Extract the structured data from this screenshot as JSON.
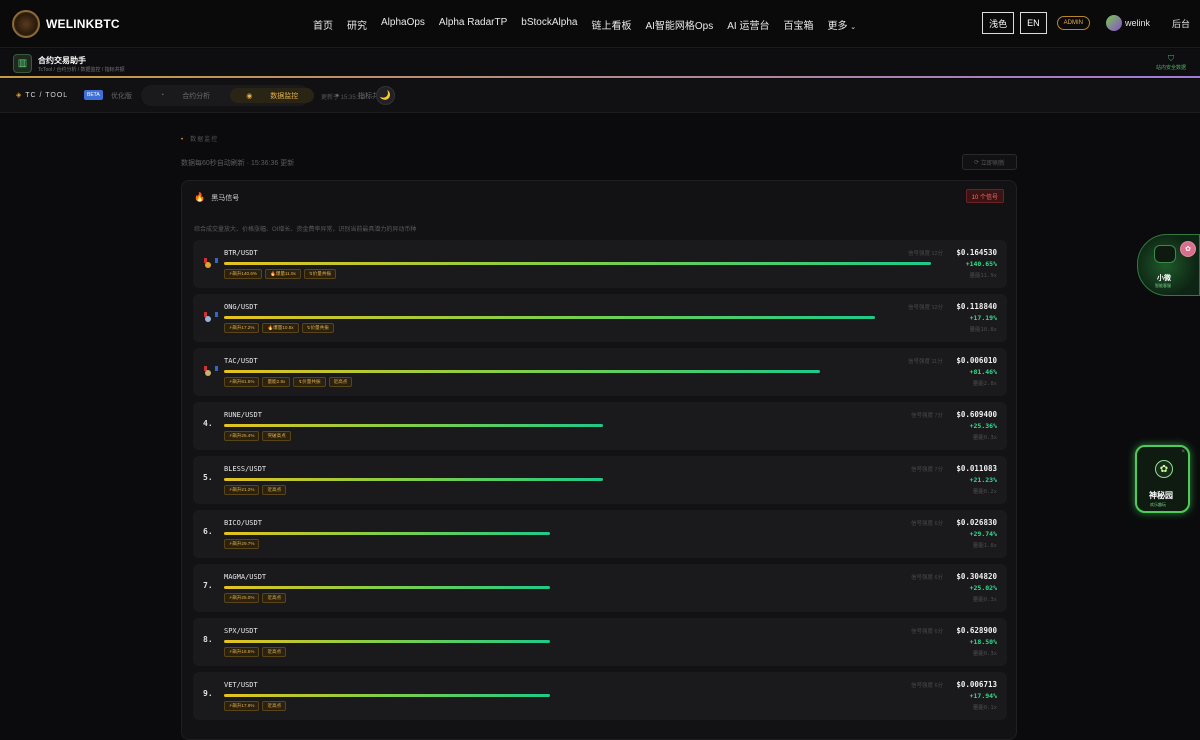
{
  "nav": {
    "brand": "WELINKBTC",
    "items": [
      "首页",
      "研究",
      "AlphaOps",
      "Alpha RadarTP",
      "bStockAlpha",
      "链上看板",
      "AI智能网格Ops",
      "AI 运营台",
      "百宝箱",
      "更多"
    ],
    "theme_btn": "浅色",
    "lang_btn": "EN",
    "admin_badge": "ADMIN",
    "username": "welink",
    "backend": "后台"
  },
  "tool": {
    "title": "合约交易助手",
    "breadcrumb": "TcTool / 合约分析 / 数据监控 / 指标共振",
    "safe_label": "站内安全数据"
  },
  "subbar": {
    "brand": "TC / TOOL",
    "beta": "BETA",
    "optimize": "优化版",
    "tabs": [
      "合约分析",
      "数据监控",
      "指标共振"
    ],
    "active_tab": "数据监控",
    "updated": "更新于 15:35:32"
  },
  "main": {
    "section_title": "数据监控",
    "refresh_note": "数据每60秒自动刷新 · 15:36:36 更新",
    "refresh_button": "立即刷新",
    "panel_title": "黑马信号",
    "signal_count": "10 个信号",
    "panel_desc": "综合成交量放大、价格涨幅、OI增长、资金费率异常，识别当前最具潜力的异动币种"
  },
  "rows": [
    {
      "rank": "1",
      "medal": "gold",
      "symbol": "BTR/USDT",
      "bar": 0.96,
      "tags": [
        "⚡飙升140.6%",
        "🔥爆量11.9x",
        "↯价量共振"
      ],
      "signal": "信号强度 12分",
      "price": "$0.164530",
      "change": "+140.65%",
      "volume": "量能11.9x"
    },
    {
      "rank": "2",
      "medal": "silver",
      "symbol": "ONG/USDT",
      "bar": 0.885,
      "tags": [
        "⚡飙升17.2%",
        "🔥爆量10.8x",
        "↯价量共振"
      ],
      "signal": "信号强度 12分",
      "price": "$0.118840",
      "change": "+17.19%",
      "volume": "量能10.8x"
    },
    {
      "rank": "3",
      "medal": "bronze",
      "symbol": "TAC/USDT",
      "bar": 0.81,
      "tags": [
        "⚡飙升81.5%",
        "量能2.8x",
        "↯价量共振",
        "近高点"
      ],
      "signal": "信号强度 11分",
      "price": "$0.006010",
      "change": "+81.46%",
      "volume": "量能2.8x"
    },
    {
      "rank": "4.",
      "medal": "",
      "symbol": "RUNE/USDT",
      "bar": 0.515,
      "tags": [
        "⚡飙升25.4%",
        "突破高点"
      ],
      "signal": "信号强度 7分",
      "price": "$0.609400",
      "change": "+25.36%",
      "volume": "量能0.3x"
    },
    {
      "rank": "5.",
      "medal": "",
      "symbol": "BLESS/USDT",
      "bar": 0.515,
      "tags": [
        "⚡飙升21.2%",
        "近高点"
      ],
      "signal": "信号强度 7分",
      "price": "$0.011083",
      "change": "+21.23%",
      "volume": "量能0.2x"
    },
    {
      "rank": "6.",
      "medal": "",
      "symbol": "BICO/USDT",
      "bar": 0.443,
      "tags": [
        "⚡飙升29.7%"
      ],
      "signal": "信号强度 6分",
      "price": "$0.026830",
      "change": "+29.74%",
      "volume": "量能1.8x"
    },
    {
      "rank": "7.",
      "medal": "",
      "symbol": "MAGMA/USDT",
      "bar": 0.443,
      "tags": [
        "⚡飙升25.0%",
        "近高点"
      ],
      "signal": "信号强度 6分",
      "price": "$0.304820",
      "change": "+25.02%",
      "volume": "量能0.3x"
    },
    {
      "rank": "8.",
      "medal": "",
      "symbol": "SPX/USDT",
      "bar": 0.443,
      "tags": [
        "⚡飙升18.5%",
        "近高点"
      ],
      "signal": "信号强度 6分",
      "price": "$0.628900",
      "change": "+18.50%",
      "volume": "量能0.3x"
    },
    {
      "rank": "9.",
      "medal": "",
      "symbol": "VET/USDT",
      "bar": 0.443,
      "tags": [
        "⚡飙升17.9%",
        "近高点"
      ],
      "signal": "信号强度 6分",
      "price": "$0.006713",
      "change": "+17.94%",
      "volume": "量能0.1x"
    }
  ],
  "widgets": {
    "assistant_name": "小微",
    "assistant_sub": "智能客服",
    "garden_name": "神秘园",
    "garden_sub": "欢乐趣玩"
  },
  "colors": {
    "accent_gold": "#e3b04b",
    "up_green": "#2fdc8a",
    "bar_start": "#e6c21e",
    "bar_end": "#1ec98a"
  }
}
